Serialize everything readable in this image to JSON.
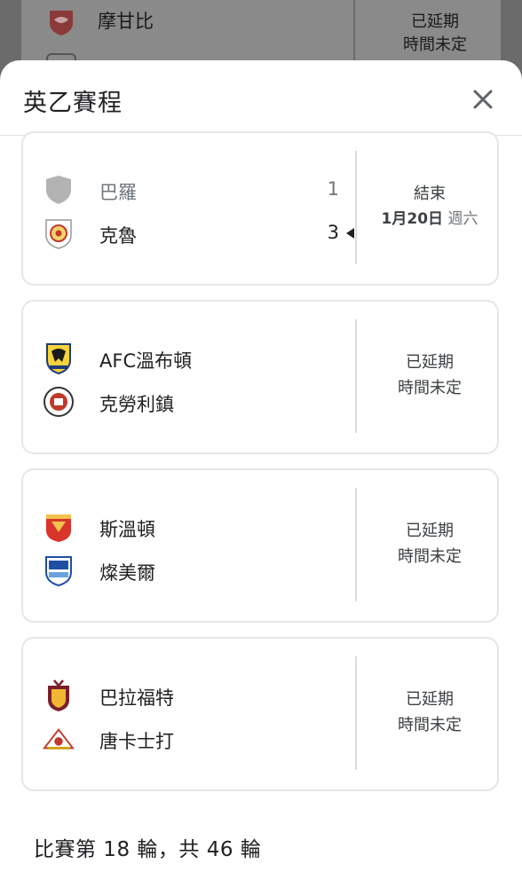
{
  "background": {
    "match": {
      "team": "摩甘比",
      "status_line1": "已延期",
      "status_line2": "時間未定"
    }
  },
  "sheet": {
    "title": "英乙賽程",
    "close_icon": "close-icon"
  },
  "matches": [
    {
      "home": {
        "name": "巴羅",
        "score": "1",
        "crest": "shield-placeholder-icon"
      },
      "away": {
        "name": "克魯",
        "score": "3",
        "crest": "crewe-crest-icon"
      },
      "status": "結束",
      "date_day": "1月20日",
      "date_weekday": "週六"
    },
    {
      "home": {
        "name": "AFC溫布頓",
        "crest": "afc-wimbledon-crest-icon"
      },
      "away": {
        "name": "克勞利鎮",
        "crest": "crawley-town-crest-icon"
      },
      "status_line1": "已延期",
      "status_line2": "時間未定"
    },
    {
      "home": {
        "name": "斯溫頓",
        "crest": "swindon-crest-icon"
      },
      "away": {
        "name": "燦美爾",
        "crest": "tranmere-crest-icon"
      },
      "status_line1": "已延期",
      "status_line2": "時間未定"
    },
    {
      "home": {
        "name": "巴拉福特",
        "crest": "bradford-crest-icon"
      },
      "away": {
        "name": "唐卡士打",
        "crest": "doncaster-crest-icon"
      },
      "status_line1": "已延期",
      "status_line2": "時間未定"
    }
  ],
  "round_info": "比賽第 18 輪，共 46 輪"
}
